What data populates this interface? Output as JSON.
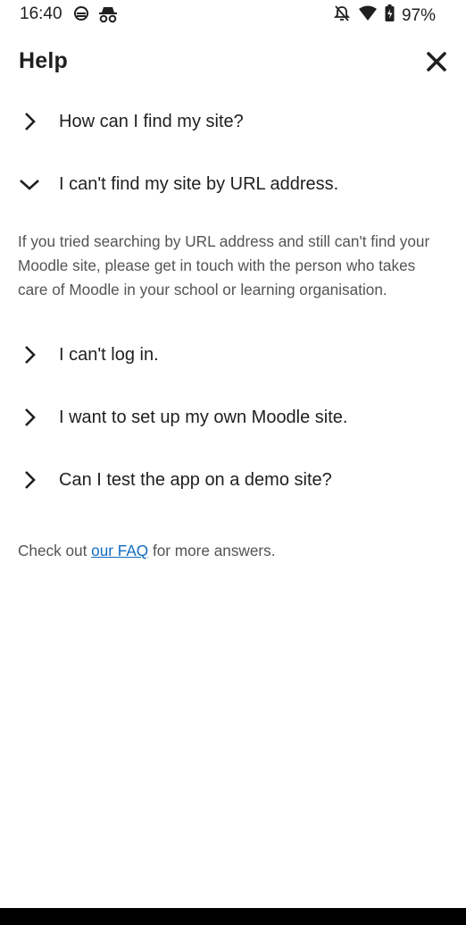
{
  "status_bar": {
    "time": "16:40",
    "battery": "97%",
    "icons": [
      "data-saver-icon",
      "incognito-icon",
      "bell-off-icon",
      "wifi-icon",
      "battery-icon"
    ]
  },
  "header": {
    "title": "Help",
    "close_icon": "close-icon"
  },
  "faq": {
    "items": [
      {
        "label": "How can I find my site?",
        "expanded": false
      },
      {
        "label": "I can't find my site by URL address.",
        "expanded": true,
        "answer": "If you tried searching by URL address and still can't find your Moodle site, please get in touch with the person who takes care of Moodle in your school or learning organisation."
      },
      {
        "label": "I can't log in.",
        "expanded": false
      },
      {
        "label": "I want to set up my own Moodle site.",
        "expanded": false
      },
      {
        "label": "Can I test the app on a demo site?",
        "expanded": false
      }
    ]
  },
  "footer": {
    "prefix": "Check out ",
    "link_text": "our FAQ",
    "suffix": " for more answers."
  },
  "colors": {
    "text": "#1f1f1f",
    "secondary_text": "#545454",
    "link": "#0f6cbf",
    "background": "#ffffff"
  }
}
